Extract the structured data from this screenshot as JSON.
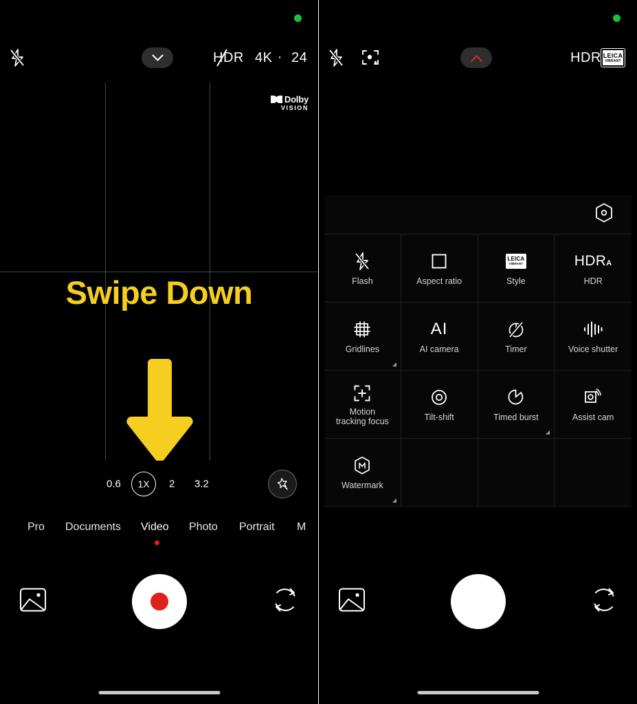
{
  "left_screen": {
    "status": {
      "recording_indicator": "recording-active",
      "indicator_color": "#19c13a"
    },
    "top_bar": {
      "flash_icon": "flash-off-icon",
      "expand_button": "chevron-down-icon",
      "hdr_label": "HDR",
      "resolution_label": "4K",
      "separator": "·",
      "fps_label": "24"
    },
    "viewfinder": {
      "dolby_brand": "Dolby",
      "dolby_sub": "VISION",
      "overlay_text": "Swipe Down",
      "overlay_color": "#F5CE1F",
      "arrow_icon": "down-arrow-icon",
      "gridlines": "3x3-grid"
    },
    "zoom_bar": {
      "levels": [
        "0.6",
        "1X",
        "2",
        "3.2"
      ],
      "selected": "1X",
      "magic_button": "magic-wand-icon"
    },
    "modes": {
      "items": [
        "Pro",
        "Documents",
        "Video",
        "Photo",
        "Portrait",
        "M"
      ],
      "active": "Video"
    },
    "shutter_bar": {
      "gallery_icon": "gallery-image-icon",
      "record_button": "record-button",
      "flip_icon": "flip-camera-icon"
    },
    "home_indicator": "home-gesture-bar"
  },
  "right_screen": {
    "status": {
      "recording_indicator": "recording-active",
      "indicator_color": "#19c13a"
    },
    "top_bar": {
      "flash_icon": "flash-off-icon",
      "focus_icon": "motion-tracking-focus-icon",
      "collapse_button": "chevron-up-icon",
      "collapse_color": "#c42b2b",
      "hdr_label": "HDR",
      "style_badge_line1": "LEICA",
      "style_badge_line2": "VIBRANT"
    },
    "settings_panel": {
      "more_settings_icon": "hexagon-settings-icon",
      "items": [
        {
          "label": "Flash",
          "icon": "flash-off-icon",
          "expandable": false
        },
        {
          "label": "Aspect ratio",
          "icon": "square-ratio-icon",
          "expandable": false
        },
        {
          "label": "Style",
          "icon": "leica-vibrant-badge-icon",
          "badge_line1": "LEICA",
          "badge_line2": "VIBRANT",
          "expandable": false
        },
        {
          "label": "HDR",
          "icon": "hdr-auto-icon",
          "icon_text": "HDR",
          "icon_sub": "A",
          "expandable": false
        },
        {
          "label": "Gridlines",
          "icon": "gridlines-icon",
          "expandable": true
        },
        {
          "label": "AI camera",
          "icon": "ai-icon",
          "icon_text": "AI",
          "expandable": false
        },
        {
          "label": "Timer",
          "icon": "timer-off-icon",
          "expandable": false
        },
        {
          "label": "Voice shutter",
          "icon": "voice-shutter-icon",
          "expandable": false
        },
        {
          "label": "Motion\ntracking focus",
          "label_line1": "Motion",
          "label_line2": "tracking focus",
          "icon": "motion-tracking-focus-icon",
          "expandable": false
        },
        {
          "label": "Tilt-shift",
          "icon": "tilt-shift-icon",
          "expandable": false
        },
        {
          "label": "Timed burst",
          "icon": "timed-burst-icon",
          "expandable": true
        },
        {
          "label": "Assist cam",
          "icon": "assist-cam-icon",
          "expandable": false
        },
        {
          "label": "Watermark",
          "icon": "watermark-hexagon-icon",
          "expandable": true
        }
      ]
    },
    "shutter_bar": {
      "gallery_icon": "gallery-image-icon",
      "shutter_button": "photo-shutter-button",
      "flip_icon": "flip-camera-icon"
    },
    "home_indicator": "home-gesture-bar"
  }
}
